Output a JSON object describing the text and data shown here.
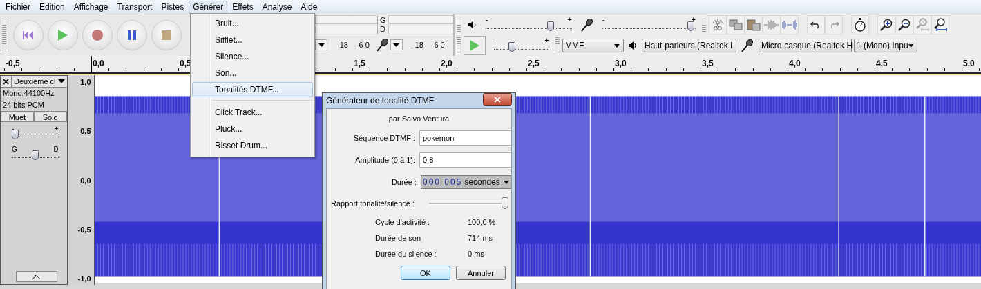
{
  "menu_bar": [
    {
      "label": "Fichier",
      "selected": false
    },
    {
      "label": "Edition",
      "selected": false
    },
    {
      "label": "Affichage",
      "selected": false
    },
    {
      "label": "Transport",
      "selected": false
    },
    {
      "label": "Pistes",
      "selected": false
    },
    {
      "label": "Générer",
      "selected": true
    },
    {
      "label": "Effets",
      "selected": false
    },
    {
      "label": "Analyse",
      "selected": false
    },
    {
      "label": "Aide",
      "selected": false
    }
  ],
  "generate_menu": {
    "groups": [
      {
        "items": [
          {
            "label": "Bruit...",
            "selected": false
          },
          {
            "label": "Sifflet...",
            "selected": false
          },
          {
            "label": "Silence...",
            "selected": false
          },
          {
            "label": "Son...",
            "selected": false
          },
          {
            "label": "Tonalités DTMF...",
            "selected": true
          }
        ]
      },
      {
        "items": [
          {
            "label": "Click Track...",
            "selected": false
          },
          {
            "label": "Pluck...",
            "selected": false
          },
          {
            "label": "Risset Drum...",
            "selected": false
          }
        ]
      }
    ]
  },
  "meter_toolbar": {
    "channels": [
      "G",
      "D"
    ],
    "playback_scale": [
      "-18",
      "-6 0"
    ],
    "recording_scale": [
      "-18",
      "-6 0"
    ]
  },
  "mixer": {
    "output_volume": {
      "labels": [
        "-",
        "+"
      ],
      "level": 0.75
    },
    "input_volume": {
      "labels": [
        "-",
        "+"
      ],
      "level": 0.95
    }
  },
  "play_at_speed": {
    "labels": [
      "-",
      "+"
    ],
    "level": 0.33
  },
  "devices": {
    "host": "MME",
    "output": "Haut-parleurs (Realtek I",
    "input": "Micro-casque (Realtek H",
    "channels": "1 (Mono) Inpu"
  },
  "ruler": [
    "-0,5",
    "0,0",
    "0,5",
    "1,5",
    "2,0",
    "2,5",
    "3,0",
    "3,5",
    "4,0",
    "4,5",
    "5,0"
  ],
  "track": {
    "name": "Deuxième cl",
    "format": "Mono,44100Hz",
    "bit_depth": "24 bits PCM",
    "buttons": [
      {
        "label": "Muet",
        "selected": false
      },
      {
        "label": "Solo",
        "selected": false
      }
    ],
    "gain": {
      "labels": [
        "-",
        "+"
      ],
      "level": 0.08
    },
    "pan": {
      "labels": [
        "G",
        "D"
      ],
      "level": 0.5
    },
    "scale": [
      "1,0",
      "0,5",
      "0,0",
      "-0,5",
      "-1,0"
    ]
  },
  "dialog": {
    "title": "Générateur de tonalité DTMF",
    "author": "par Salvo Ventura",
    "fields": [
      {
        "label": "Séquence DTMF :",
        "value": "pokemon"
      },
      {
        "label": "Amplitude (0 à 1):",
        "value": "0,8"
      }
    ],
    "duration": {
      "label": "Durée :",
      "value": "000 005",
      "unit": "secondes"
    },
    "ratio": {
      "label": "Rapport tonalité/silence :",
      "level": 1
    },
    "stats": [
      {
        "label": "Cycle d'activité :",
        "value": "100,0 %"
      },
      {
        "label": "Durée de son",
        "value": "714 ms"
      },
      {
        "label": "Durée du silence :",
        "value": "0 ms"
      }
    ],
    "buttons": [
      {
        "label": "OK",
        "kind": "default"
      },
      {
        "label": "Annuler",
        "kind": "normal"
      }
    ]
  }
}
